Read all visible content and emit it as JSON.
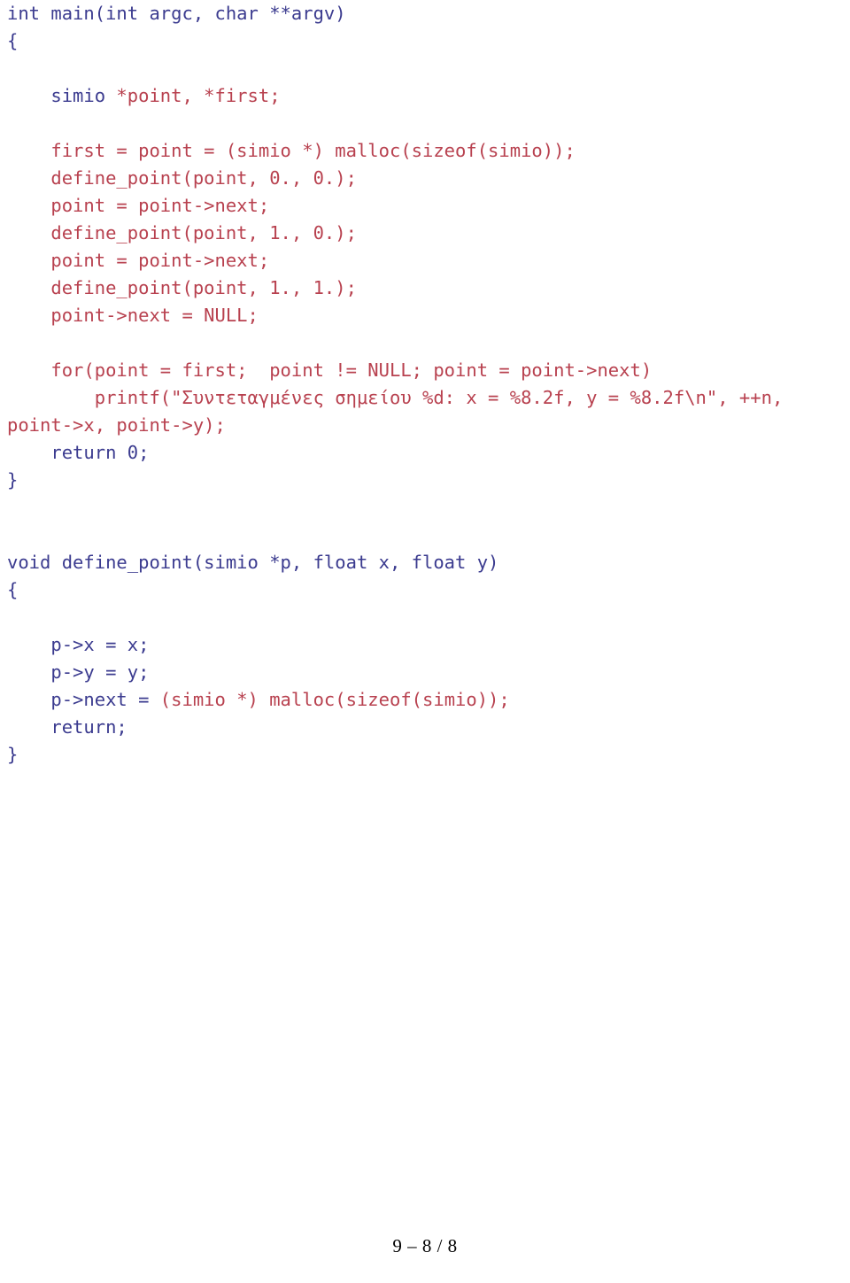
{
  "document": {
    "kind": "source-code-listing",
    "language": "C",
    "background_color": "#ffffff"
  },
  "colors": {
    "keyword": "#3b3b8f",
    "body": "#b8414f",
    "footer": "#000000"
  },
  "code": {
    "lines": [
      {
        "indent": 0,
        "blank": false,
        "spans": [
          {
            "cls": "c-key",
            "text": "int main(int argc, char **argv)"
          }
        ]
      },
      {
        "indent": 0,
        "blank": false,
        "spans": [
          {
            "cls": "c-key",
            "text": "{"
          }
        ]
      },
      {
        "indent": 0,
        "blank": true,
        "spans": []
      },
      {
        "indent": 0,
        "blank": false,
        "spans": [
          {
            "cls": "c-key",
            "text": "    simio "
          },
          {
            "cls": "c-body",
            "text": "*point, *first;"
          }
        ]
      },
      {
        "indent": 0,
        "blank": true,
        "spans": []
      },
      {
        "indent": 0,
        "blank": false,
        "spans": [
          {
            "cls": "c-body",
            "text": "    first = point = (simio *) malloc(sizeof(simio));"
          }
        ]
      },
      {
        "indent": 0,
        "blank": false,
        "spans": [
          {
            "cls": "c-body",
            "text": "    define_point(point, 0., 0.);"
          }
        ]
      },
      {
        "indent": 0,
        "blank": false,
        "spans": [
          {
            "cls": "c-body",
            "text": "    point = point->next;"
          }
        ]
      },
      {
        "indent": 0,
        "blank": false,
        "spans": [
          {
            "cls": "c-body",
            "text": "    define_point(point, 1., 0.);"
          }
        ]
      },
      {
        "indent": 0,
        "blank": false,
        "spans": [
          {
            "cls": "c-body",
            "text": "    point = point->next;"
          }
        ]
      },
      {
        "indent": 0,
        "blank": false,
        "spans": [
          {
            "cls": "c-body",
            "text": "    define_point(point, 1., 1.);"
          }
        ]
      },
      {
        "indent": 0,
        "blank": false,
        "spans": [
          {
            "cls": "c-body",
            "text": "    point->next = NULL;"
          }
        ]
      },
      {
        "indent": 0,
        "blank": true,
        "spans": []
      },
      {
        "indent": 0,
        "blank": false,
        "spans": [
          {
            "cls": "c-body",
            "text": "    for(point = first;  point != NULL; point = point->next)"
          }
        ]
      },
      {
        "indent": 0,
        "blank": false,
        "overflow": true,
        "spans": [
          {
            "cls": "c-body",
            "text": "        printf(\"Συντεταγμένες σημείου %d: x = %8.2f, y = %8.2f\\n\", ++n,"
          }
        ]
      },
      {
        "indent": 0,
        "blank": false,
        "spans": [
          {
            "cls": "c-body",
            "text": "point->x, point->y);"
          }
        ]
      },
      {
        "indent": 0,
        "blank": false,
        "spans": [
          {
            "cls": "c-key",
            "text": "    return 0;"
          }
        ]
      },
      {
        "indent": 0,
        "blank": false,
        "spans": [
          {
            "cls": "c-key",
            "text": "}"
          }
        ]
      },
      {
        "indent": 0,
        "blank": true,
        "spans": []
      },
      {
        "indent": 0,
        "blank": true,
        "spans": []
      },
      {
        "indent": 0,
        "blank": false,
        "spans": [
          {
            "cls": "c-key",
            "text": "void define_point(simio *p, float x, float y)"
          }
        ]
      },
      {
        "indent": 0,
        "blank": false,
        "spans": [
          {
            "cls": "c-key",
            "text": "{"
          }
        ]
      },
      {
        "indent": 0,
        "blank": true,
        "spans": []
      },
      {
        "indent": 0,
        "blank": false,
        "spans": [
          {
            "cls": "c-key",
            "text": "    p->x = x;"
          }
        ]
      },
      {
        "indent": 0,
        "blank": false,
        "spans": [
          {
            "cls": "c-key",
            "text": "    p->y = y;"
          }
        ]
      },
      {
        "indent": 0,
        "blank": false,
        "spans": [
          {
            "cls": "c-key",
            "text": "    p->next = "
          },
          {
            "cls": "c-body",
            "text": "(simio *) malloc(sizeof(simio));"
          }
        ]
      },
      {
        "indent": 0,
        "blank": false,
        "spans": [
          {
            "cls": "c-key",
            "text": "    return;"
          }
        ]
      },
      {
        "indent": 0,
        "blank": false,
        "spans": [
          {
            "cls": "c-key",
            "text": "}"
          }
        ]
      }
    ]
  },
  "footer": {
    "page_marker": "9 – 8 / 8"
  }
}
